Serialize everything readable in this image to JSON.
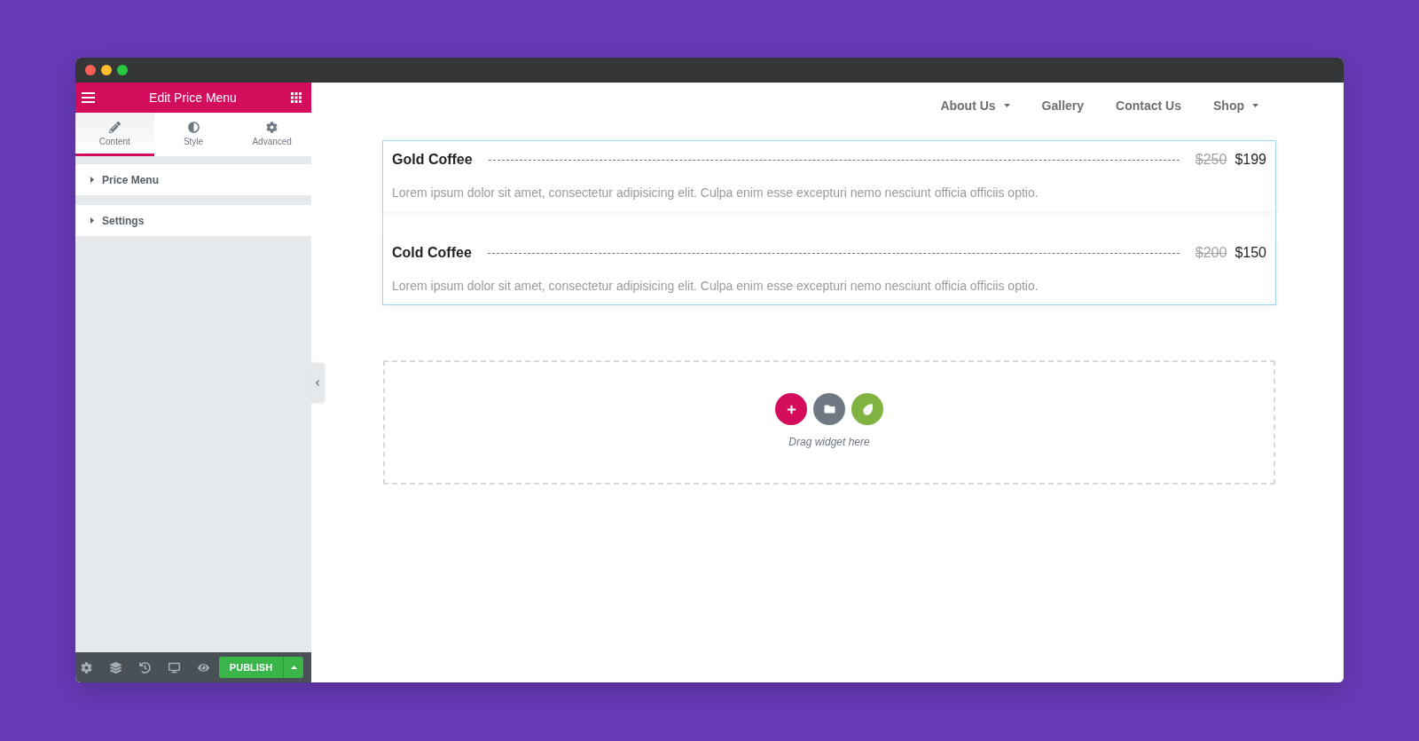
{
  "editor": {
    "title": "Edit Price Menu",
    "tabs": [
      {
        "label": "Content",
        "selected": true
      },
      {
        "label": "Style",
        "selected": false
      },
      {
        "label": "Advanced",
        "selected": false
      }
    ],
    "sections": [
      {
        "label": "Price Menu",
        "expanded": false
      },
      {
        "label": "Settings",
        "expanded": false
      }
    ],
    "footer": {
      "publish": "PUBLISH"
    }
  },
  "nav": [
    {
      "label": "About Us",
      "dropdown": true
    },
    {
      "label": "Gallery",
      "dropdown": false
    },
    {
      "label": "Contact Us",
      "dropdown": false
    },
    {
      "label": "Shop",
      "dropdown": true
    }
  ],
  "price_menu": {
    "items": [
      {
        "title": "Gold Coffee",
        "old_price": "$250",
        "price": "$199",
        "description": "Lorem ipsum dolor sit amet, consectetur adipisicing elit. Culpa enim esse excepturi nemo nesciunt officia officiis optio."
      },
      {
        "title": "Cold Coffee",
        "old_price": "$200",
        "price": "$150",
        "description": "Lorem ipsum dolor sit amet, consectetur adipisicing elit. Culpa enim esse excepturi nemo nesciunt officia officiis optio."
      }
    ]
  },
  "drop_zone": {
    "hint": "Drag widget here"
  }
}
